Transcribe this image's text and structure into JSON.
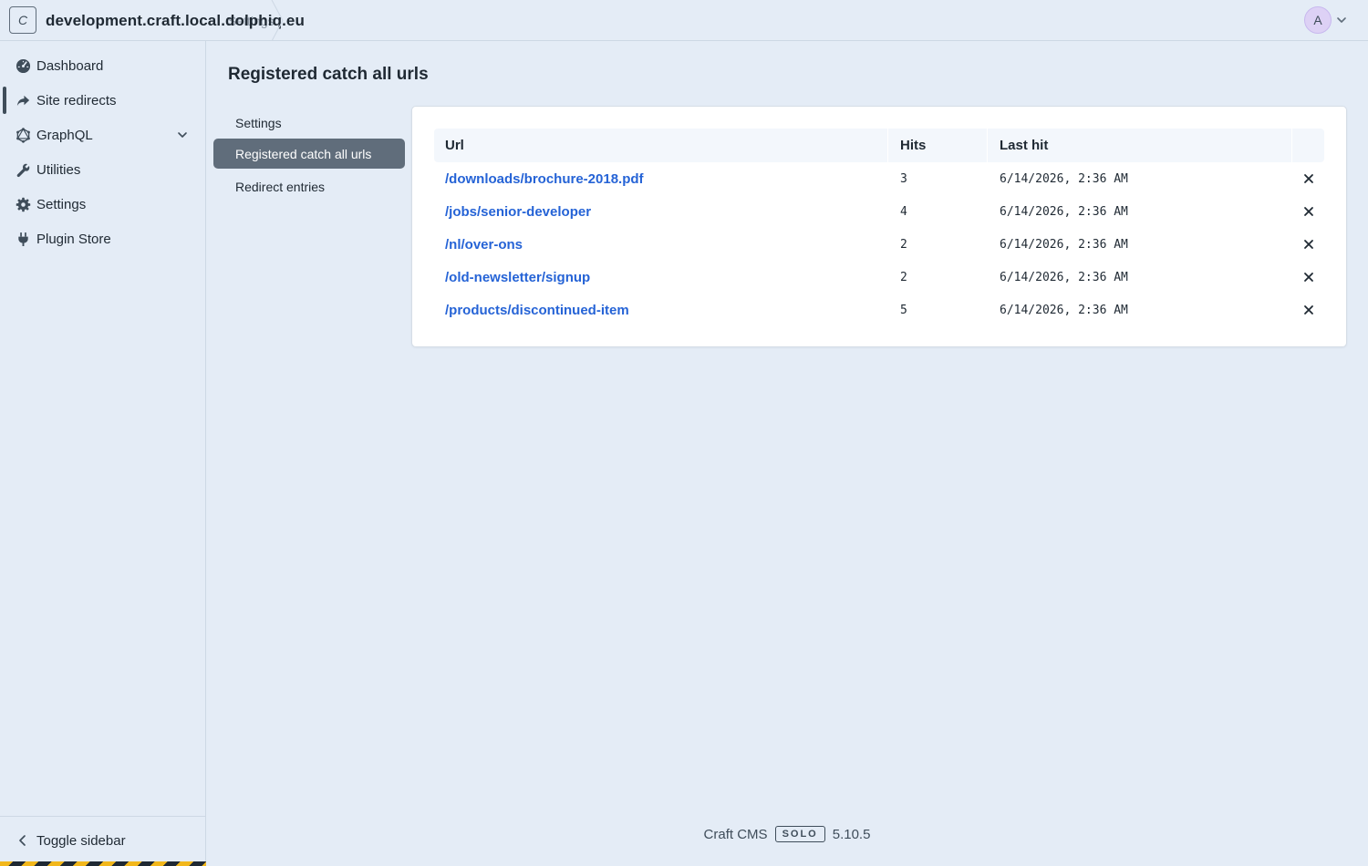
{
  "header": {
    "site_icon_letter": "C",
    "site_name": "development.craft.local.dolphiq.eu",
    "breadcrumb_ghost": "Settings",
    "avatar_letter": "A"
  },
  "sidebar": {
    "items": [
      {
        "label": "Dashboard",
        "icon": "gauge-icon"
      },
      {
        "label": "Site redirects",
        "icon": "share-arrow-icon",
        "active": true
      },
      {
        "label": "GraphQL",
        "icon": "graphql-icon",
        "expandable": true
      },
      {
        "label": "Utilities",
        "icon": "wrench-icon"
      },
      {
        "label": "Settings",
        "icon": "gear-icon"
      },
      {
        "label": "Plugin Store",
        "icon": "plug-icon"
      }
    ],
    "toggle_label": "Toggle sidebar"
  },
  "main": {
    "title": "Registered catch all urls",
    "subnav": [
      {
        "label": "Settings"
      },
      {
        "label": "Registered catch all urls",
        "selected": true
      },
      {
        "label": "Redirect entries"
      }
    ],
    "table": {
      "columns": [
        "Url",
        "Hits",
        "Last hit"
      ],
      "rows": [
        {
          "url": "/downloads/brochure-2018.pdf",
          "hits": "3",
          "last_hit": "6/14/2026, 2:36 AM"
        },
        {
          "url": "/jobs/senior-developer",
          "hits": "4",
          "last_hit": "6/14/2026, 2:36 AM"
        },
        {
          "url": "/nl/over-ons",
          "hits": "2",
          "last_hit": "6/14/2026, 2:36 AM"
        },
        {
          "url": "/old-newsletter/signup",
          "hits": "2",
          "last_hit": "6/14/2026, 2:36 AM"
        },
        {
          "url": "/products/discontinued-item",
          "hits": "5",
          "last_hit": "6/14/2026, 2:36 AM"
        }
      ]
    }
  },
  "footer": {
    "product": "Craft CMS",
    "edition": "SOLO",
    "version": "5.10.5"
  },
  "colors": {
    "background": "#e4ecf6",
    "link": "#2563d6",
    "selected_subnav": "#606d7b",
    "avatar": "#ddd1f5"
  }
}
